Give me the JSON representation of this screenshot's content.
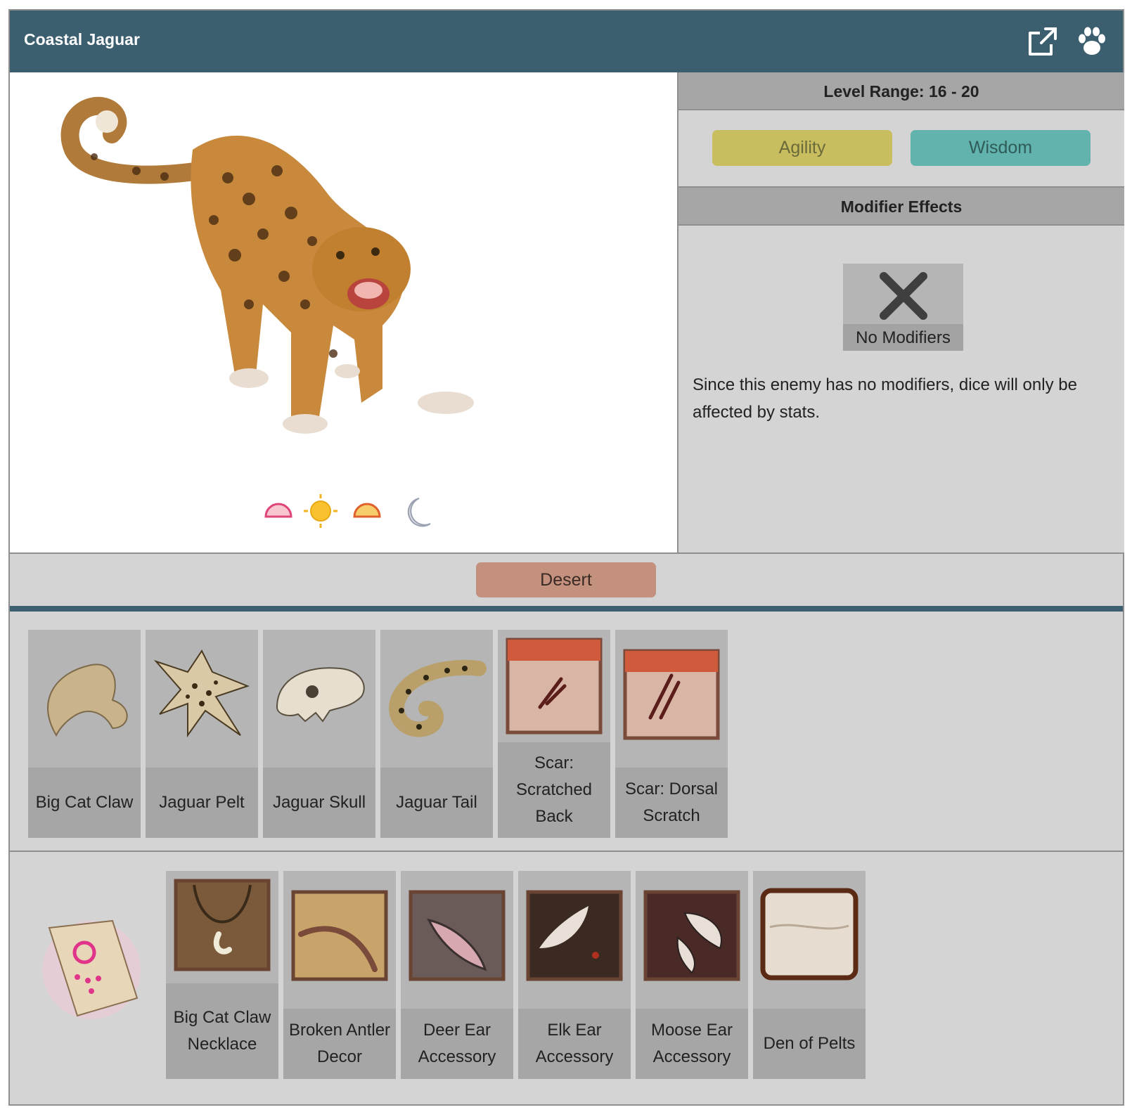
{
  "header": {
    "title": "Coastal Jaguar",
    "external_link_icon": "external-link-icon",
    "paw_icon": "paw-icon"
  },
  "time_of_day": [
    "dawn-icon",
    "day-icon",
    "dusk-icon",
    "night-icon"
  ],
  "level_range": "Level Range: 16 - 20",
  "stats": [
    {
      "label": "Agility",
      "color": "#c8bd5f"
    },
    {
      "label": "Wisdom",
      "color": "#62b3ae"
    }
  ],
  "modifier_effects": {
    "heading": "Modifier Effects",
    "no_modifiers_label": "No Modifiers",
    "description": "Since this enemy has no modifiers, dice will only be affected by stats."
  },
  "biome": {
    "label": "Desert",
    "color": "#c4917f"
  },
  "drops": [
    {
      "name": "Big Cat Claw",
      "icon": "claw-icon"
    },
    {
      "name": "Jaguar Pelt",
      "icon": "pelt-icon"
    },
    {
      "name": "Jaguar Skull",
      "icon": "skull-icon"
    },
    {
      "name": "Jaguar Tail",
      "icon": "tail-icon"
    },
    {
      "name": "Scar: Scratched Back",
      "icon": "scar-back-icon"
    },
    {
      "name": "Scar: Dorsal Scratch",
      "icon": "scar-dorsal-icon"
    }
  ],
  "rewards": [
    {
      "name": "Big Cat Claw Necklace",
      "icon": "necklace-icon"
    },
    {
      "name": "Broken Antler Decor",
      "icon": "antler-icon"
    },
    {
      "name": "Deer Ear Accessory",
      "icon": "deer-ear-icon"
    },
    {
      "name": "Elk Ear Accessory",
      "icon": "elk-ear-icon"
    },
    {
      "name": "Moose Ear Accessory",
      "icon": "moose-ear-icon"
    },
    {
      "name": "Den of Pelts",
      "icon": "den-icon"
    }
  ],
  "colors": {
    "header": "#3c5f70",
    "panel": "#d4d4d4",
    "tile": "#b5b5b5"
  }
}
